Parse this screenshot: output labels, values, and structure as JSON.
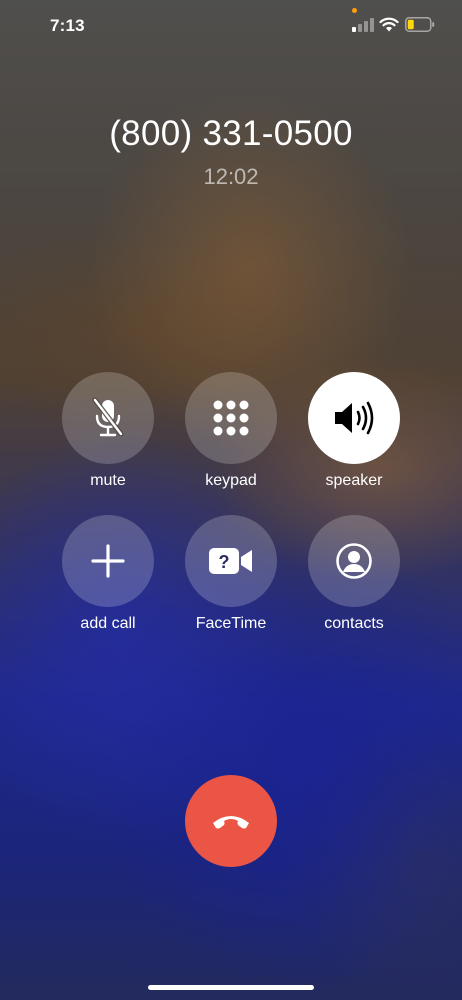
{
  "status_bar": {
    "time": "7:13",
    "signal_icon": "cellular-signal-icon",
    "wifi_icon": "wifi-icon",
    "battery_icon": "battery-low-icon",
    "recording_dot_color": "#ff9f0a"
  },
  "call": {
    "number": "(800) 331-0500",
    "duration": "12:02"
  },
  "controls": {
    "mute": {
      "label": "mute",
      "icon": "mic-slash-icon",
      "active": false
    },
    "keypad": {
      "label": "keypad",
      "icon": "keypad-grid-icon",
      "active": false
    },
    "speaker": {
      "label": "speaker",
      "icon": "speaker-wave-icon",
      "active": true
    },
    "add_call": {
      "label": "add call",
      "icon": "plus-icon",
      "active": false
    },
    "facetime": {
      "label": "FaceTime",
      "icon": "facetime-video-icon",
      "active": false
    },
    "contacts": {
      "label": "contacts",
      "icon": "person-circle-icon",
      "active": false
    }
  },
  "end_call": {
    "icon": "phone-hangup-icon",
    "color": "#eb5545"
  },
  "colors": {
    "button_fill": "rgba(255,255,255,0.2)",
    "button_active_fill": "#ffffff",
    "text": "#ffffff"
  }
}
